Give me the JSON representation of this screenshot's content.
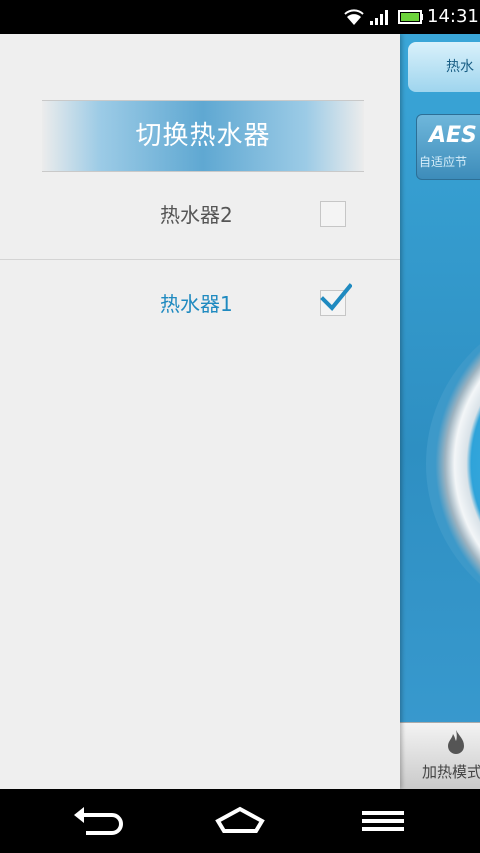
{
  "status_bar": {
    "time": "14:31",
    "icons": [
      "wifi-icon",
      "signal-icon",
      "battery-icon"
    ],
    "battery_color": "#6cd33b"
  },
  "drawer": {
    "title": "切换热水器",
    "items": [
      {
        "label": "热水器2",
        "checked": false
      },
      {
        "label": "热水器1",
        "checked": true
      }
    ],
    "selected_color": "#1f8ac0"
  },
  "background_app": {
    "tab_label": "热水",
    "aes_logo": "AES",
    "aes_sub": "自适应节",
    "bottom_label": "加热模式",
    "bottom_icon": "flame-icon"
  },
  "nav_bar": {
    "buttons": [
      "back-icon",
      "home-icon",
      "menu-icon"
    ]
  }
}
